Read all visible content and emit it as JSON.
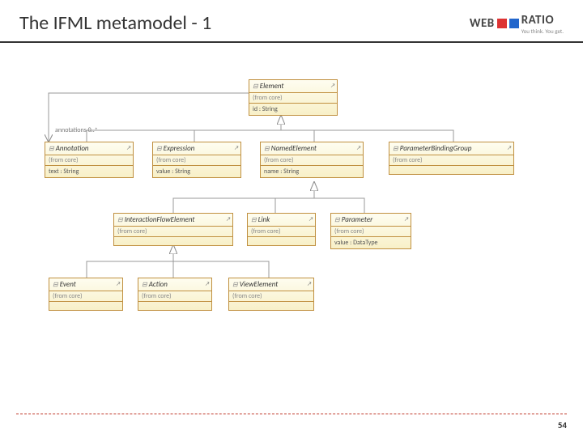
{
  "header": {
    "title": "The IFML metamodel - 1",
    "logo": {
      "brand_web": "WEB",
      "brand_ratio": "RATIO",
      "tagline": "You think. You get."
    }
  },
  "annotation_label": "annotations  0..*",
  "classes": {
    "element": {
      "name": "Element",
      "pkg": "(from core)",
      "attr": "id : String"
    },
    "annotation": {
      "name": "Annotation",
      "pkg": "(from core)",
      "attr": "text : String"
    },
    "expression": {
      "name": "Expression",
      "pkg": "(from core)",
      "attr": "value : String"
    },
    "namedelement": {
      "name": "NamedElement",
      "pkg": "(from core)",
      "attr": "name : String"
    },
    "paramgrp": {
      "name": "ParameterBindingGroup",
      "pkg": "(from core)",
      "attr": ""
    },
    "ife": {
      "name": "InteractionFlowElement",
      "pkg": "(from core)",
      "attr": ""
    },
    "link": {
      "name": "Link",
      "pkg": "(from core)",
      "attr": ""
    },
    "parameter": {
      "name": "Parameter",
      "pkg": "(from core)",
      "attr": "value : DataType"
    },
    "event": {
      "name": "Event",
      "pkg": "(from core)",
      "attr": ""
    },
    "action": {
      "name": "Action",
      "pkg": "(from core)",
      "attr": ""
    },
    "viewelement": {
      "name": "ViewElement",
      "pkg": "(from core)",
      "attr": ""
    }
  },
  "page_number": "54"
}
